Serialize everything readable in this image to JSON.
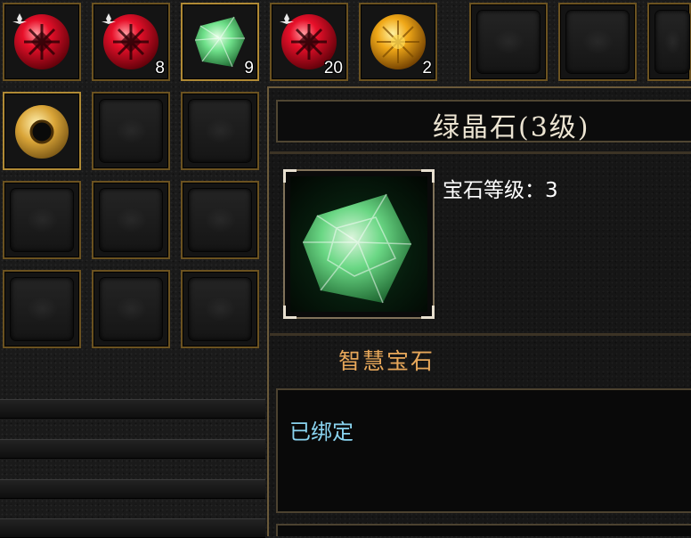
{
  "inventory": {
    "top_row": [
      {
        "icon": "red-gem-icon",
        "count": ""
      },
      {
        "icon": "red-gem-icon",
        "count": "8"
      },
      {
        "icon": "green-gem-icon",
        "count": "9",
        "selected": true
      },
      {
        "icon": "red-gem-icon",
        "count": "20"
      },
      {
        "icon": "yellow-gem-icon",
        "count": "2"
      },
      {
        "icon": "",
        "count": ""
      },
      {
        "icon": "",
        "count": ""
      },
      {
        "icon": "",
        "count": ""
      }
    ],
    "grid": [
      {
        "icon": "gold-ring-icon"
      },
      {
        "icon": ""
      },
      {
        "icon": ""
      },
      {
        "icon": ""
      },
      {
        "icon": ""
      },
      {
        "icon": ""
      },
      {
        "icon": ""
      },
      {
        "icon": ""
      },
      {
        "icon": ""
      }
    ]
  },
  "tooltip": {
    "title": "绿晶石(3级)",
    "level_label": "宝石等级：",
    "level_value": "3",
    "gem_type": "智慧宝石",
    "binding": "已绑定",
    "icon": "green-gem-icon"
  },
  "colors": {
    "slot_border": "#6b5220",
    "title_text": "#ece4d2",
    "gem_type_text": "#e8a85a",
    "binding_text": "#8ad4f0"
  }
}
